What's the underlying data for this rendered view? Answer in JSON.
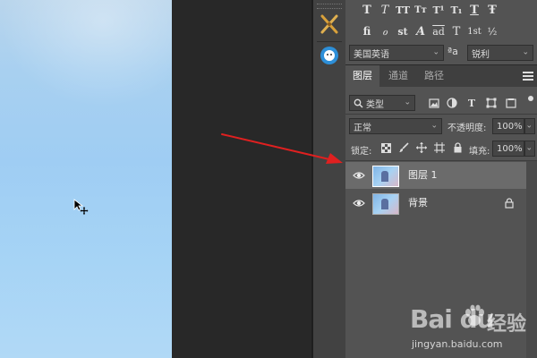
{
  "character_panel": {
    "style_glyphs": [
      "T",
      "T",
      "TT",
      "Tт",
      "T¹",
      "T₁",
      "T",
      "Ŧ"
    ],
    "opentype_glyphs": [
      "fi",
      "ℴ",
      "st",
      "A",
      "ad",
      "T",
      "1st",
      "½"
    ],
    "language_select": "美国英语",
    "aa_label": "ªa",
    "antialias_select": "锐利"
  },
  "layers_panel": {
    "tabs": [
      {
        "label": "图层",
        "active": true
      },
      {
        "label": "通道",
        "active": false
      },
      {
        "label": "路径",
        "active": false
      }
    ],
    "filter_select": "类型",
    "blend_mode": "正常",
    "opacity_label": "不透明度:",
    "opacity_value": "100%",
    "lock_label": "锁定:",
    "fill_label": "填充:",
    "fill_value": "100%",
    "layers": [
      {
        "name": "图层 1",
        "selected": true,
        "locked": false
      },
      {
        "name": "背景",
        "selected": false,
        "locked": true
      }
    ]
  },
  "annotation": {
    "arrow_color": "#e02020"
  },
  "watermark": {
    "logo": "Bai du",
    "cn": "经验",
    "url": "jingyan.baidu.com"
  },
  "colors": {
    "panel_bg": "#535353",
    "pasteboard": "#282828",
    "selected_layer": "#6b6b6b",
    "canvas_sky": "#a5d3f5"
  }
}
